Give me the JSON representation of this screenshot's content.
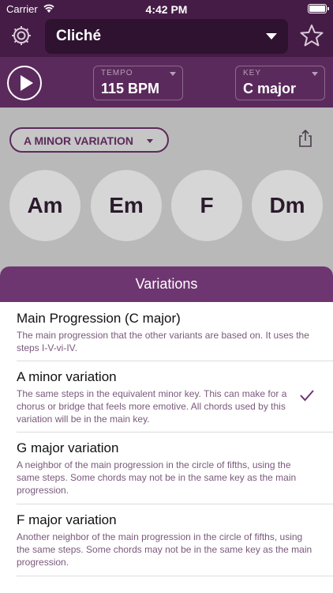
{
  "status": {
    "carrier": "Carrier",
    "time": "4:42 PM"
  },
  "toolbar": {
    "song": "Cliché"
  },
  "controls": {
    "tempo_caption": "TEMPO",
    "tempo_value": "115 BPM",
    "key_caption": "KEY",
    "key_value": "C major"
  },
  "variation": {
    "selected": "A MINOR VARIATION"
  },
  "chords": [
    "Am",
    "Em",
    "F",
    "Dm"
  ],
  "sheet": {
    "title": "Variations",
    "items": [
      {
        "title": "Main Progression (C major)",
        "desc": "The main progression that the other variants are based on. It uses the steps I-V-vi-IV.",
        "checked": false
      },
      {
        "title": "A minor variation",
        "desc": "The same steps in the equivalent minor key. This can make for a chorus or bridge that feels more emotive. All chords used by this variation will be in the main key.",
        "checked": true
      },
      {
        "title": "G major variation",
        "desc": "A neighbor of the main progression in the circle of fifths, using the same steps. Some chords may not be in the same key as the main progression.",
        "checked": false
      },
      {
        "title": "F major variation",
        "desc": "Another neighbor of the main progression in the circle of fifths, using the same steps. Some chords may not be in the same key as the main progression.",
        "checked": false
      }
    ]
  },
  "icons": [
    "wifi-icon",
    "battery-icon",
    "gear-icon",
    "star-icon",
    "play-icon",
    "share-icon",
    "checkmark-icon"
  ],
  "colors": {
    "header": "#451c46",
    "controls": "#5b2a5c",
    "sheet_header": "#6e3670",
    "accent_text": "#7a5a7c"
  }
}
